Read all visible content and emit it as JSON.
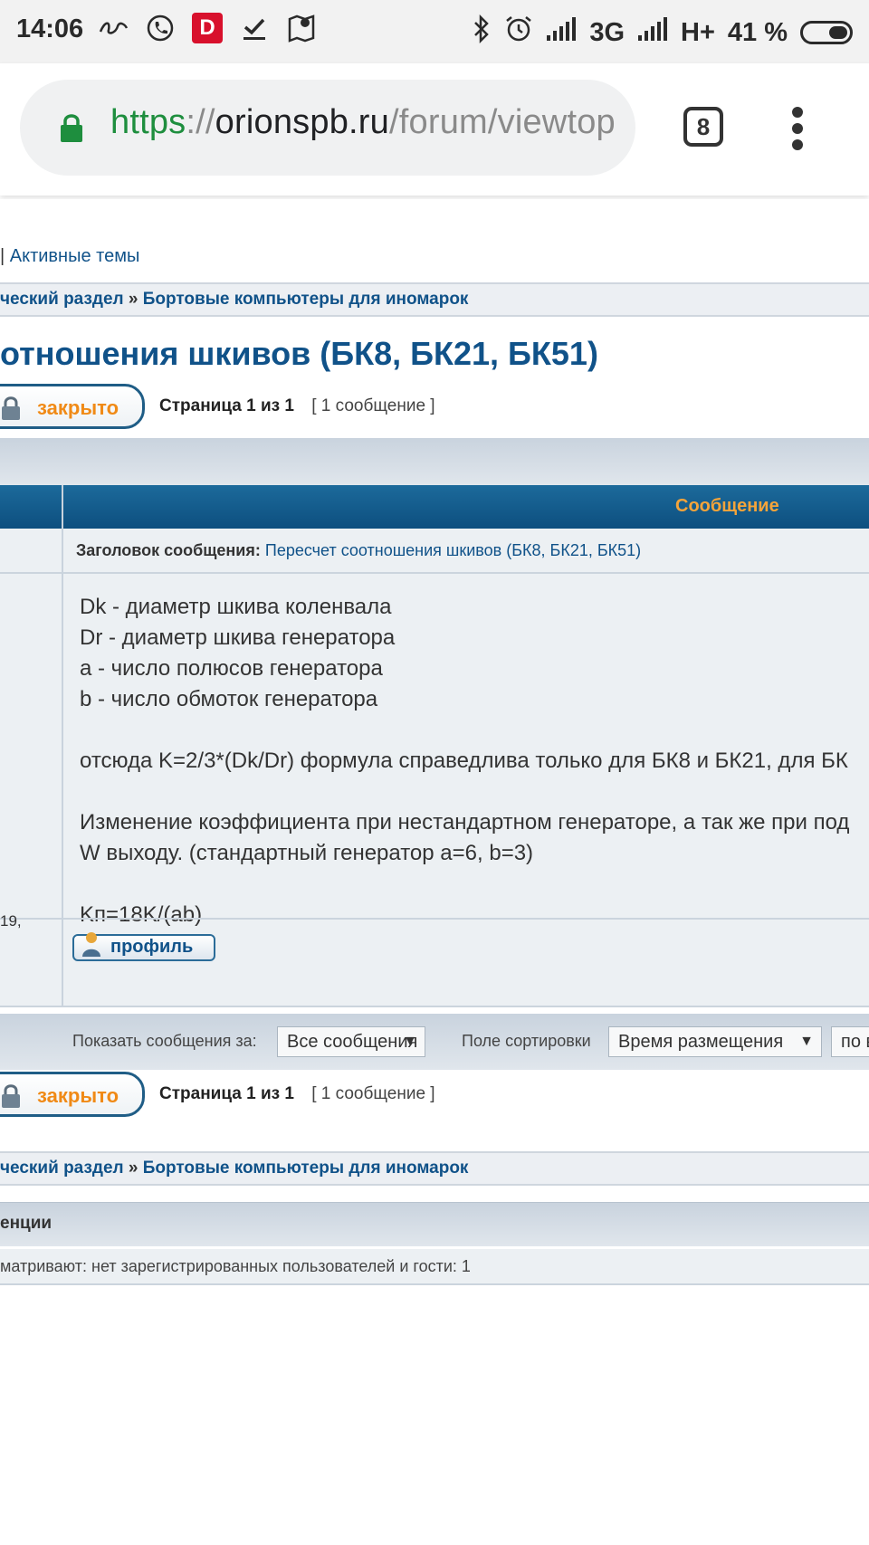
{
  "status_bar": {
    "time": "14:06",
    "battery_percent": "41 %",
    "network_1": "3G",
    "network_2": "H+",
    "icons": [
      "swype-icon",
      "phone-icon",
      "d-app-icon",
      "download-done-icon",
      "maps-icon",
      "bluetooth-icon",
      "alarm-icon",
      "signal-icon",
      "battery-icon"
    ]
  },
  "browser": {
    "url_scheme": "https",
    "url_sep": "://",
    "url_host": "orionspb.ru",
    "url_path": "/forum/viewtop",
    "tab_count": "8"
  },
  "forum": {
    "top_sep": "|",
    "active_topics": "Активные темы",
    "breadcrumb_section": "ческий раздел",
    "breadcrumb_sep": "»",
    "breadcrumb_forum": "Бортовые компьютеры для иномарок",
    "topic_title": "отношения шкивов (БК8, БК21, БК51)",
    "locked_label": "закрыто",
    "pagination": "Страница 1 из 1",
    "post_count": "[ 1 сообщение ]",
    "column_message": "Сообщение",
    "subject_label": "Заголовок сообщения:",
    "subject_value": "Пересчет соотношения шкивов (БК8, БК21, БК51)",
    "author_date_fragment": "19,",
    "post_lines": [
      "Dk - диаметр шкива коленвала",
      "Dr - диаметр шкива генератора",
      "a - число полюсов генератора",
      "b - число обмоток генератора",
      "",
      "отсюда K=2/3*(Dk/Dr) формула справедлива только для БК8 и БК21, для БК",
      "",
      "Изменение коэффициента при нестандартном генераторе, а так же при под",
      "W выходу. (стандартный генератор a=6, b=3)",
      "",
      "Kп=18K/(ab)"
    ],
    "profile_button": "профиль",
    "sort": {
      "show_label": "Показать сообщения за:",
      "show_value": "Все сообщения",
      "field_label": "Поле сортировки",
      "field_value": "Время размещения",
      "order_value": "по в"
    },
    "online_header": "енции",
    "online_text": "матривают: нет зарегистрированных пользователей и гости: 1"
  }
}
